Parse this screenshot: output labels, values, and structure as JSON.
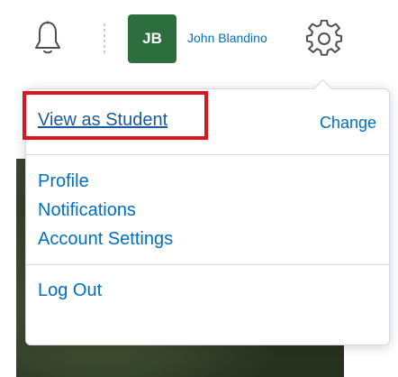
{
  "header": {
    "avatar_initials": "JB",
    "user_name": "John Blandino",
    "icons": [
      "bell-icon",
      "gear-icon"
    ],
    "avatar_color": "#2c6e3e",
    "link_color": "#006fbf"
  },
  "dropdown": {
    "role": {
      "view_as_label": "View as Student",
      "change_label": "Change"
    },
    "menu": {
      "profile": "Profile",
      "notifications": "Notifications",
      "account_settings": "Account Settings",
      "log_out": "Log Out"
    },
    "highlight_color": "#e0141e"
  }
}
